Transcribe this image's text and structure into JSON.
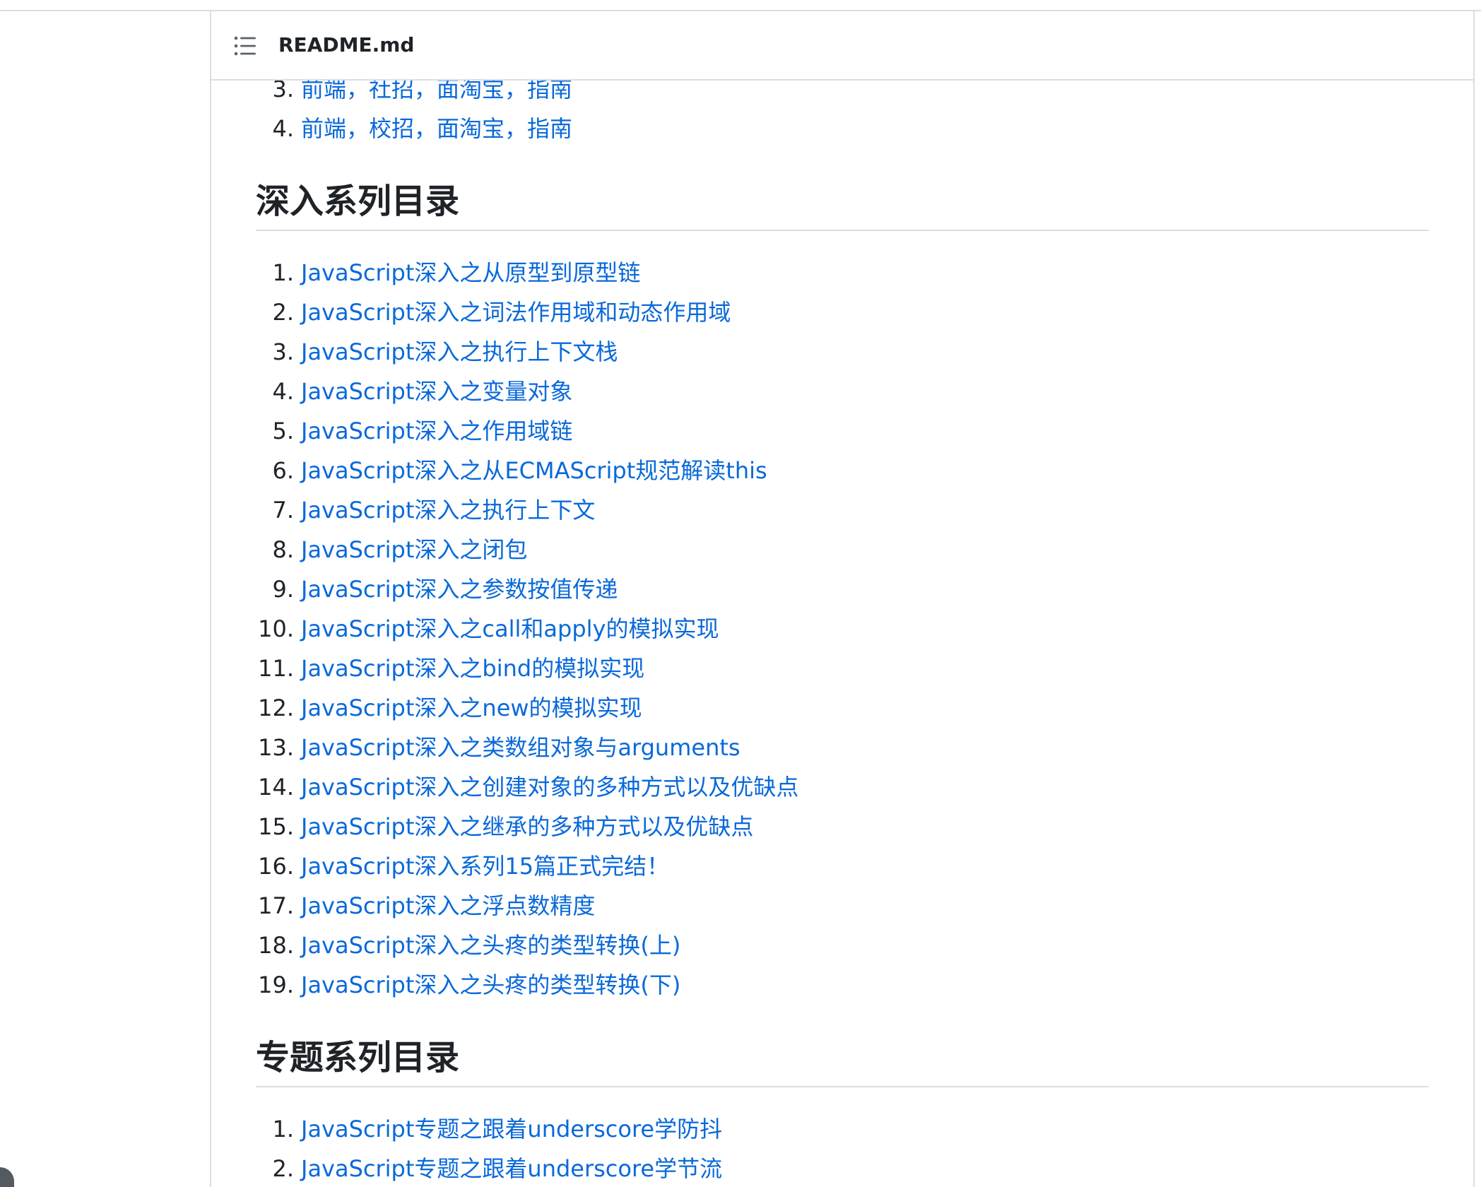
{
  "file_header": {
    "title": "README.md",
    "icon": "list-outline-icon"
  },
  "intro_list": [
    {
      "number": "3.",
      "text": "前端，社招，面淘宝，指南"
    },
    {
      "number": "4.",
      "text": "前端，校招，面淘宝，指南"
    }
  ],
  "sections": [
    {
      "title": "深入系列目录",
      "items": [
        {
          "number": "1.",
          "text": "JavaScript深入之从原型到原型链"
        },
        {
          "number": "2.",
          "text": "JavaScript深入之词法作用域和动态作用域"
        },
        {
          "number": "3.",
          "text": "JavaScript深入之执行上下文栈"
        },
        {
          "number": "4.",
          "text": "JavaScript深入之变量对象"
        },
        {
          "number": "5.",
          "text": "JavaScript深入之作用域链"
        },
        {
          "number": "6.",
          "text": "JavaScript深入之从ECMAScript规范解读this"
        },
        {
          "number": "7.",
          "text": "JavaScript深入之执行上下文"
        },
        {
          "number": "8.",
          "text": "JavaScript深入之闭包"
        },
        {
          "number": "9.",
          "text": "JavaScript深入之参数按值传递"
        },
        {
          "number": "10.",
          "text": "JavaScript深入之call和apply的模拟实现"
        },
        {
          "number": "11.",
          "text": "JavaScript深入之bind的模拟实现"
        },
        {
          "number": "12.",
          "text": "JavaScript深入之new的模拟实现"
        },
        {
          "number": "13.",
          "text": "JavaScript深入之类数组对象与arguments"
        },
        {
          "number": "14.",
          "text": "JavaScript深入之创建对象的多种方式以及优缺点"
        },
        {
          "number": "15.",
          "text": "JavaScript深入之继承的多种方式以及优缺点"
        },
        {
          "number": "16.",
          "text": "JavaScript深入系列15篇正式完结！"
        },
        {
          "number": "17.",
          "text": "JavaScript深入之浮点数精度"
        },
        {
          "number": "18.",
          "text": "JavaScript深入之头疼的类型转换(上)"
        },
        {
          "number": "19.",
          "text": "JavaScript深入之头疼的类型转换(下)"
        }
      ]
    },
    {
      "title": "专题系列目录",
      "items": [
        {
          "number": "1.",
          "text": "JavaScript专题之跟着underscore学防抖"
        },
        {
          "number": "2.",
          "text": "JavaScript专题之跟着underscore学节流"
        }
      ]
    }
  ],
  "colors": {
    "link": "#0969da",
    "text": "#1f2328",
    "border": "#d8dee4"
  }
}
